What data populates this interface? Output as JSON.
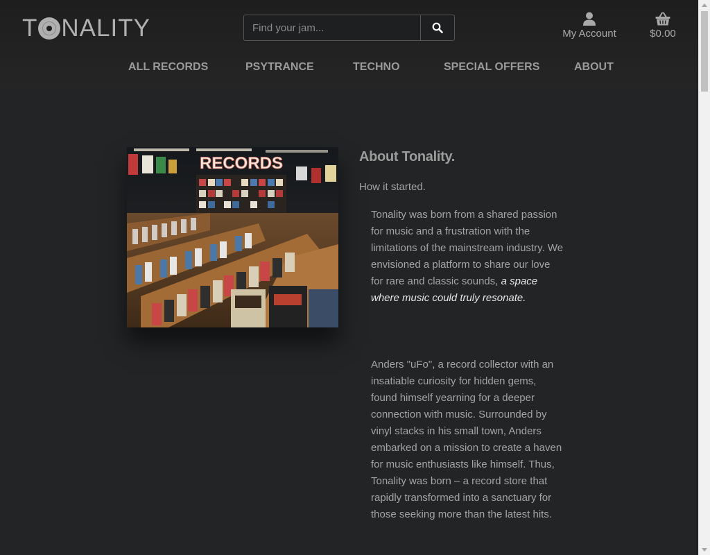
{
  "brand": {
    "logo_left": "T",
    "logo_right": "NALITY"
  },
  "search": {
    "placeholder": "Find your jam..."
  },
  "header": {
    "account_label": "My Account",
    "cart_total": "$0.00"
  },
  "nav": {
    "items": [
      {
        "label": "ALL RECORDS"
      },
      {
        "label": "PSYTRANCE"
      },
      {
        "label": "TECHNO"
      },
      {
        "label": "SPECIAL OFFERS"
      },
      {
        "label": "ABOUT"
      }
    ]
  },
  "about": {
    "title": "About Tonality.",
    "subtitle": "How it started.",
    "image_sign": "RECORDS",
    "p1_text": "Tonality was born from a shared passion for music and a frustration with the limitations of the mainstream industry. We envisioned a platform to share our love for rare and classic sounds, ",
    "p1_emphasis": "a space where music could truly resonate.",
    "p2_text": "Anders \"uFo\", a record collector with an insatiable curiosity for hidden gems, found himself yearning for a deeper connection with music. Surrounded by vinyl stacks in his small town, Anders embarked on a mission to create a haven for music enthusiasts like himself. Thus, Tonality was born – a record store that rapidly transformed into a sanctuary for those seeking more than the latest hits."
  },
  "icons": {
    "search": "search-icon",
    "account": "user-icon",
    "cart": "basket-icon"
  },
  "colors": {
    "background": "#222425",
    "header": "#1e1e1e",
    "text": "#a4a4a4",
    "emphasis": "#e6e6e6"
  }
}
